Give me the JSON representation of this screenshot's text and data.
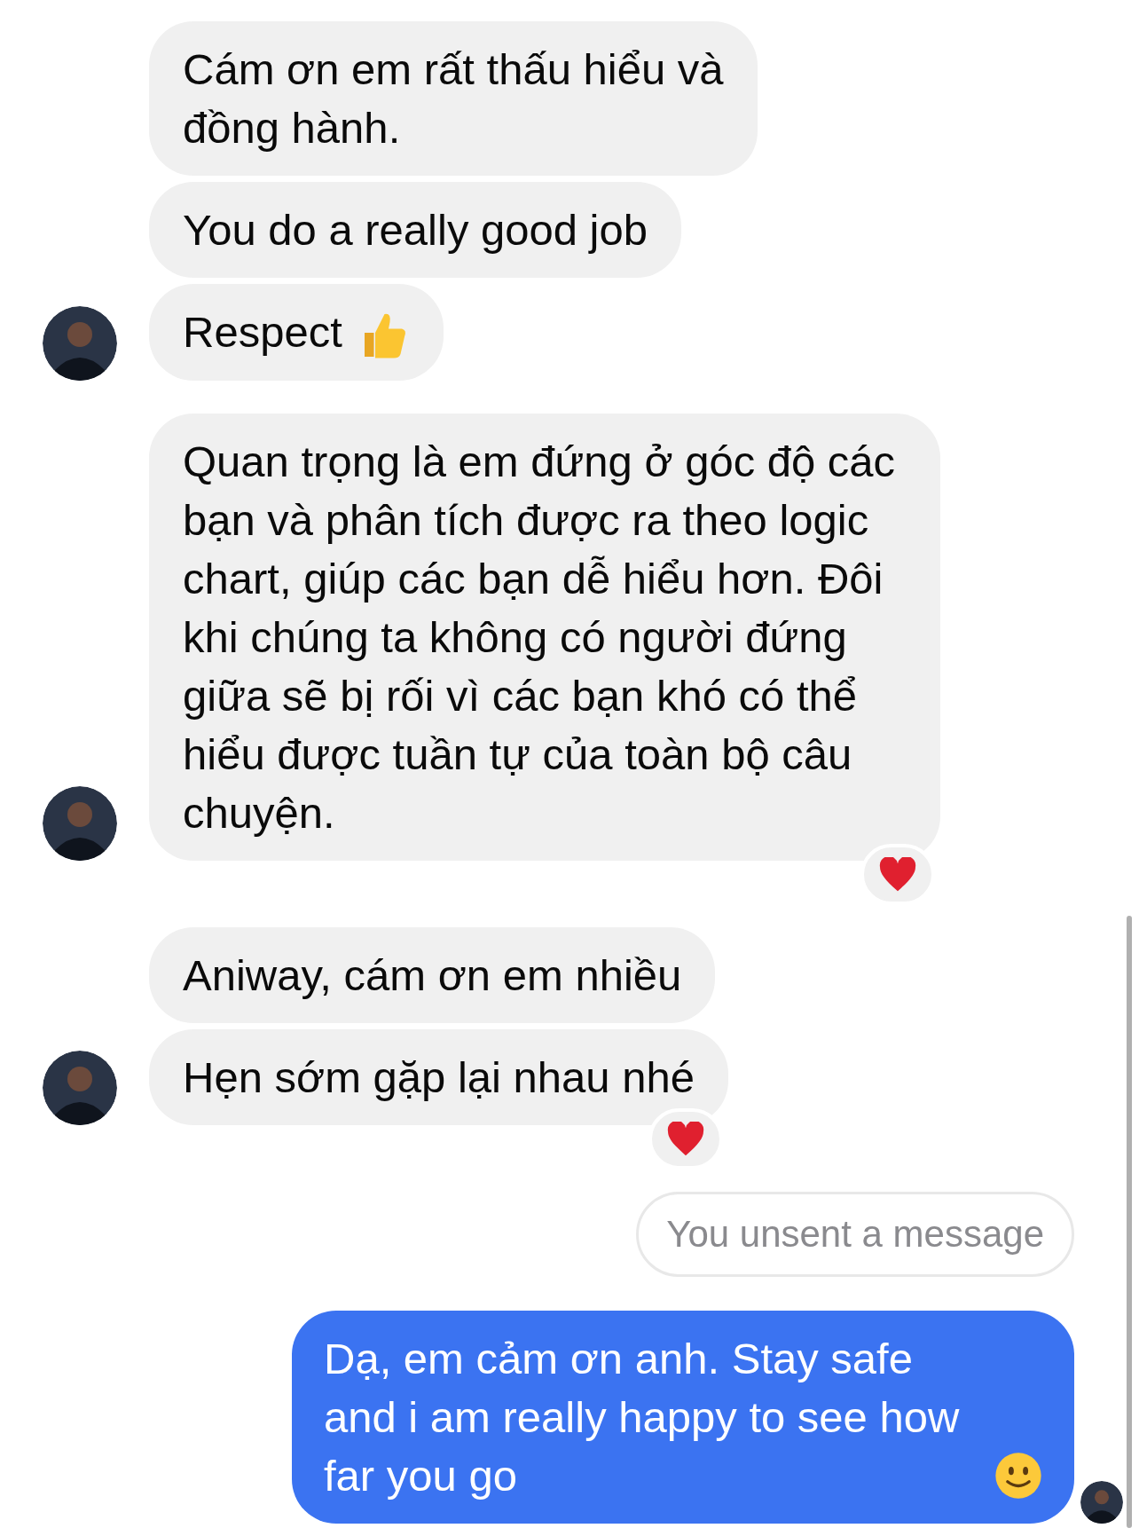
{
  "groups": [
    {
      "kind": "received",
      "avatar": true,
      "messages": [
        {
          "kind": "text",
          "text": "Cám ơn em rất thấu hiểu và\nđồng hành.",
          "reaction": false
        },
        {
          "kind": "text",
          "text": "You do a really good job",
          "reaction": false
        },
        {
          "kind": "text_thumbs_up",
          "text": "Respect",
          "reaction": false
        }
      ]
    },
    {
      "kind": "received",
      "avatar": true,
      "messages": [
        {
          "kind": "text",
          "text": "Quan trọng là em đứng ở góc độ các bạn và phân tích được ra theo logic chart, giúp các bạn dễ hiểu hơn. Đôi khi chúng ta không có người đứng giữa sẽ bị rối vì các bạn khó có thể hiểu được tuần tự của toàn bộ câu chuyện.",
          "reaction": true
        }
      ]
    },
    {
      "kind": "received",
      "avatar": true,
      "messages": [
        {
          "kind": "text",
          "text": "Aniway, cám ơn em nhiều",
          "reaction": false
        },
        {
          "kind": "text",
          "text": "Hẹn sớm gặp lại nhau nhé",
          "reaction": true
        }
      ]
    },
    {
      "kind": "sent",
      "avatar": true,
      "messages": [
        {
          "kind": "unsent",
          "text": "You unsent a message"
        },
        {
          "kind": "text_smile",
          "text": "Dạ, em cảm ơn anh. Stay safe and i am really happy to see how far you go",
          "reaction": false
        }
      ]
    }
  ]
}
